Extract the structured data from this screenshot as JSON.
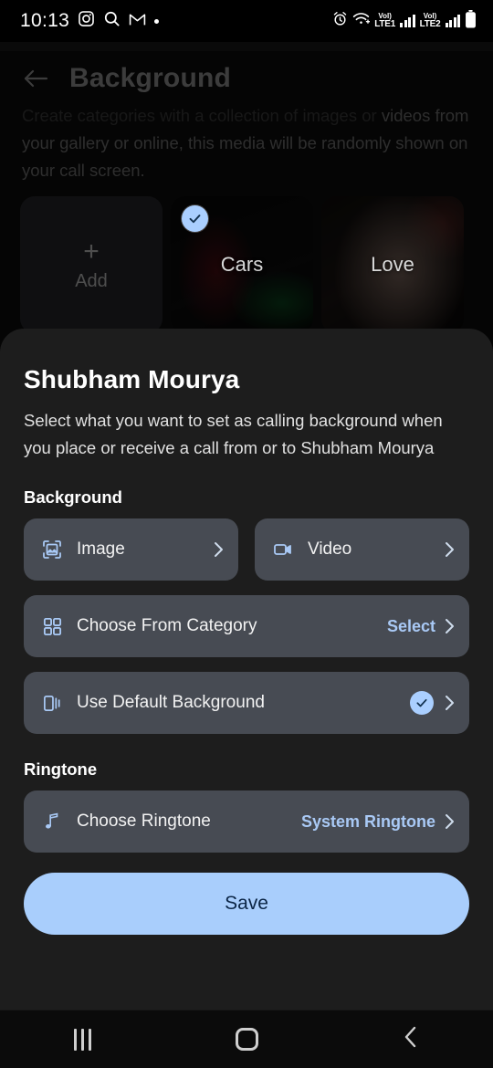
{
  "status_bar": {
    "time": "10:13",
    "left_icons": [
      "instagram-icon",
      "search-icon",
      "gmail-icon",
      "dot-indicator"
    ],
    "right_icons": [
      "alarm-icon",
      "wifi-icon",
      "volte-lte1-icon",
      "signal-bars-1",
      "volte-lte2-icon",
      "signal-bars-2",
      "battery-icon"
    ],
    "sim1_label_top": "VoI)",
    "sim1_label_bottom": "LTE1",
    "sim2_label_top": "VoI)",
    "sim2_label_bottom": "LTE2"
  },
  "page": {
    "title": "Background",
    "back_icon": "arrow-left-icon",
    "description_faded": "Create categories with a collection of images or",
    "description": "videos from your gallery or online, this media will be randomly shown on your call screen.",
    "categories": [
      {
        "id": "add",
        "label": "Add",
        "icon": "plus-icon",
        "selected": false
      },
      {
        "id": "cars",
        "label": "Cars",
        "selected": true
      },
      {
        "id": "love",
        "label": "Love",
        "selected": false
      }
    ]
  },
  "sheet": {
    "title": "Shubham Mourya",
    "description": "Select what you want to set as calling background when you place or receive a call from or to Shubham Mourya",
    "background_section": {
      "label": "Background",
      "image_option": {
        "label": "Image",
        "icon": "image-frame-icon",
        "chevron": "chevron-right-icon"
      },
      "video_option": {
        "label": "Video",
        "icon": "video-camera-icon",
        "chevron": "chevron-right-icon"
      },
      "category_option": {
        "label": "Choose From Category",
        "icon": "grid-icon",
        "value": "Select",
        "chevron": "chevron-right-icon"
      },
      "default_option": {
        "label": "Use Default Background",
        "icon": "layers-icon",
        "badge": "check-circle-icon",
        "chevron": "chevron-right-icon",
        "selected": true
      }
    },
    "ringtone_section": {
      "label": "Ringtone",
      "ringtone_option": {
        "label": "Choose Ringtone",
        "icon": "music-note-icon",
        "value": "System Ringtone",
        "chevron": "chevron-right-icon"
      }
    },
    "save_label": "Save"
  },
  "nav_bar": {
    "recents": "recents-icon",
    "home": "home-icon",
    "back": "back-icon"
  },
  "colors": {
    "accent": "#a9cefc",
    "sheet_bg": "#1d1d1d",
    "row_bg": "#474b53",
    "save_text": "#0b2545"
  }
}
